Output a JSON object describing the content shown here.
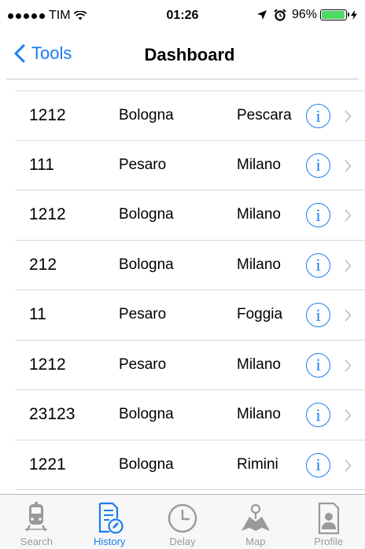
{
  "status_bar": {
    "carrier": "TIM",
    "time": "01:26",
    "battery": "96%",
    "battery_level": 0.96
  },
  "nav": {
    "back_label": "Tools",
    "title": "Dashboard"
  },
  "rows": [
    {
      "id": "1212",
      "from": "Bologna",
      "to": "Pescara"
    },
    {
      "id": "111",
      "from": "Pesaro",
      "to": "Milano"
    },
    {
      "id": "1212",
      "from": "Bologna",
      "to": "Milano"
    },
    {
      "id": "212",
      "from": "Bologna",
      "to": "Milano"
    },
    {
      "id": "11",
      "from": "Pesaro",
      "to": "Foggia"
    },
    {
      "id": "1212",
      "from": "Pesaro",
      "to": "Milano"
    },
    {
      "id": "23123",
      "from": "Bologna",
      "to": "Milano"
    },
    {
      "id": "1221",
      "from": "Bologna",
      "to": "Rimini"
    }
  ],
  "tabs": [
    {
      "label": "Search",
      "icon": "train-icon",
      "active": false
    },
    {
      "label": "History",
      "icon": "history-edit-icon",
      "active": true
    },
    {
      "label": "Delay",
      "icon": "clock-icon",
      "active": false
    },
    {
      "label": "Map",
      "icon": "map-icon",
      "active": false
    },
    {
      "label": "Profile",
      "icon": "profile-icon",
      "active": false
    }
  ],
  "colors": {
    "accent": "#1a7cf4",
    "battery": "#4cd964",
    "inactive_tab": "#9a9a9a"
  }
}
